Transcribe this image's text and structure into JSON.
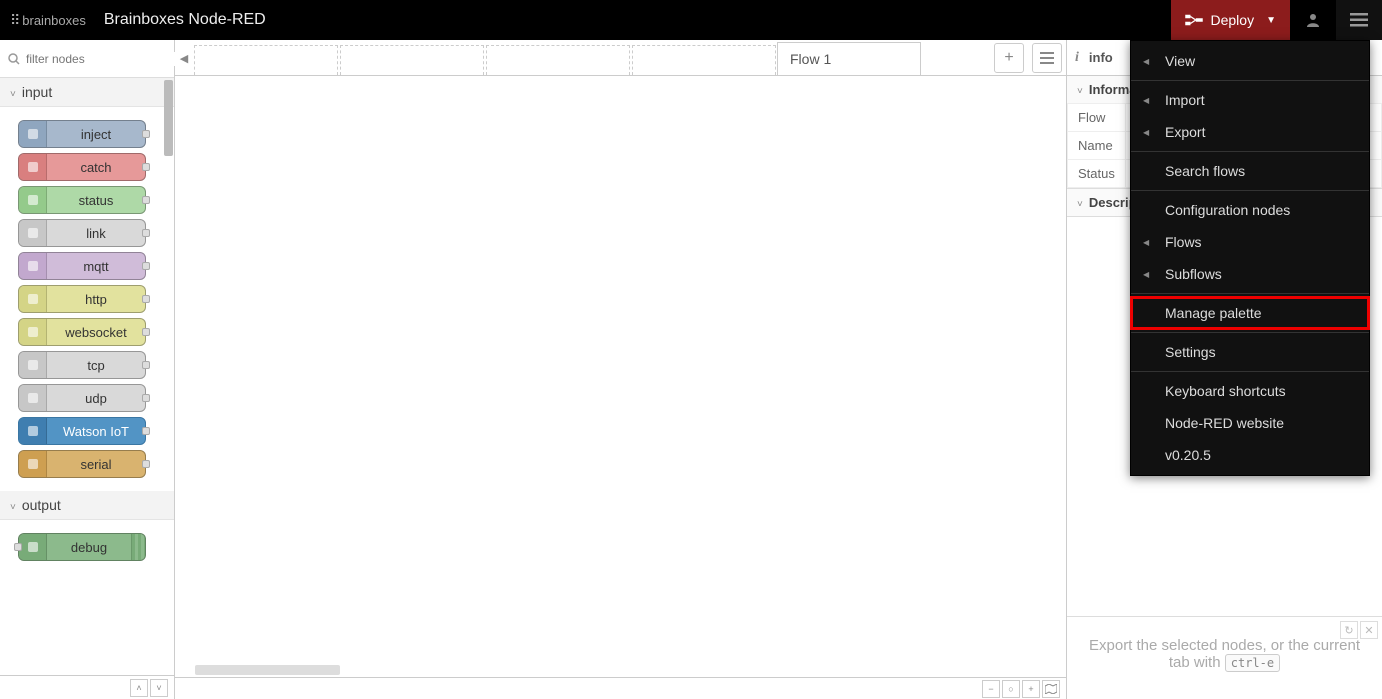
{
  "header": {
    "logo_text": "brainboxes",
    "title": "Brainboxes Node-RED",
    "deploy_label": "Deploy"
  },
  "palette": {
    "search_placeholder": "filter nodes",
    "categories": [
      {
        "name": "input",
        "nodes": [
          {
            "label": "inject",
            "cls": "c1",
            "port": "r"
          },
          {
            "label": "catch",
            "cls": "c2",
            "port": "r"
          },
          {
            "label": "status",
            "cls": "c3",
            "port": "r"
          },
          {
            "label": "link",
            "cls": "c4",
            "port": "r"
          },
          {
            "label": "mqtt",
            "cls": "c5",
            "port": "r"
          },
          {
            "label": "http",
            "cls": "c6",
            "port": "r"
          },
          {
            "label": "websocket",
            "cls": "c6",
            "port": "r"
          },
          {
            "label": "tcp",
            "cls": "c4",
            "port": "r"
          },
          {
            "label": "udp",
            "cls": "c4",
            "port": "r"
          },
          {
            "label": "Watson IoT",
            "cls": "c7",
            "port": "r"
          },
          {
            "label": "serial",
            "cls": "c8",
            "port": "r"
          }
        ]
      },
      {
        "name": "output",
        "nodes": [
          {
            "label": "debug",
            "cls": "c9",
            "port": "l",
            "stripes": true
          }
        ]
      }
    ]
  },
  "workspace": {
    "active_tab": "Flow 1"
  },
  "sidebar": {
    "tab_label": "info",
    "info_header": "Information",
    "rows": {
      "flow_label": "Flow",
      "name_label": "Name",
      "status_label": "Status"
    },
    "desc_header": "Description",
    "tip_pre": "Export the selected nodes, or the current tab with ",
    "tip_kbd": "ctrl-e"
  },
  "menu": {
    "items": [
      {
        "label": "View",
        "sub": true,
        "hl": false
      },
      {
        "sep": true
      },
      {
        "label": "Import",
        "sub": true,
        "hl": false
      },
      {
        "label": "Export",
        "sub": true,
        "hl": false
      },
      {
        "sep": true
      },
      {
        "label": "Search flows",
        "sub": false,
        "hl": false
      },
      {
        "sep": true
      },
      {
        "label": "Configuration nodes",
        "sub": false,
        "hl": false
      },
      {
        "label": "Flows",
        "sub": true,
        "hl": false
      },
      {
        "label": "Subflows",
        "sub": true,
        "hl": false
      },
      {
        "sep": true
      },
      {
        "label": "Manage palette",
        "sub": false,
        "hl": true
      },
      {
        "sep": true
      },
      {
        "label": "Settings",
        "sub": false,
        "hl": false
      },
      {
        "sep": true
      },
      {
        "label": "Keyboard shortcuts",
        "sub": false,
        "hl": false
      },
      {
        "label": "Node-RED website",
        "sub": false,
        "hl": false
      },
      {
        "label": "v0.20.5",
        "sub": false,
        "hl": false
      }
    ]
  }
}
